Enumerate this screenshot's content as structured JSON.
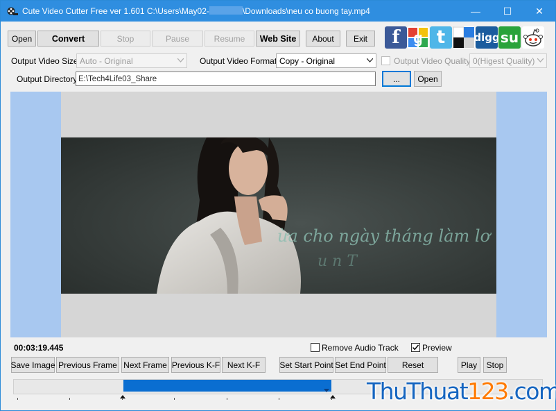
{
  "window": {
    "title_prefix": "Cute Video Cutter Free ver 1.601  C:\\Users\\May02-",
    "title_suffix": "\\Downloads\\neu co buong tay.mp4",
    "minimize": "—",
    "maximize": "☐",
    "close": "✕"
  },
  "toolbar": {
    "open": "Open",
    "convert": "Convert",
    "stop": "Stop",
    "pause": "Pause",
    "resume": "Resume",
    "website": "Web Site",
    "about": "About",
    "exit": "Exit"
  },
  "social": [
    {
      "name": "facebook-icon",
      "glyph": "f",
      "color": "#3b5998"
    },
    {
      "name": "google-icon",
      "glyph": "g",
      "color": "#ffffff"
    },
    {
      "name": "twitter-icon",
      "glyph": "t",
      "color": "#4fb6e8"
    },
    {
      "name": "delicious-icon",
      "glyph": "",
      "color": "#ffffff"
    },
    {
      "name": "digg-icon",
      "glyph": "digg",
      "color": "#1b5c9e"
    },
    {
      "name": "stumbleupon-icon",
      "glyph": "su",
      "color": "#2aa33b"
    },
    {
      "name": "reddit-icon",
      "glyph": "",
      "color": "#ffffff"
    }
  ],
  "options": {
    "video_size_label": "Output Video Size:",
    "video_size_value": "Auto - Original",
    "video_format_label": "Output Video Format:",
    "video_format_value": "Copy - Original",
    "video_quality_label": "Output Video Quality",
    "video_quality_value": "0(Higest Quality)",
    "directory_label": "Output Directory:",
    "directory_value": "E:\\Tech4Life03_Share",
    "browse": "...",
    "open_dir": "Open"
  },
  "video": {
    "overlay_text_1": "ừa cho ngày tháng làm lơ",
    "overlay_text_2": "u n T"
  },
  "playback": {
    "time": "00:03:19.445",
    "remove_audio": "Remove Audio Track",
    "preview": "Preview",
    "save_image": "Save Image",
    "previous_frame": "Previous Frame",
    "next_frame": "Next Frame",
    "previous_kf": "Previous K-F",
    "next_kf": "Next K-F",
    "set_start": "Set  Start Point",
    "set_end": "Set  End Point",
    "reset": "Reset",
    "play": "Play",
    "stop": "Stop"
  },
  "watermark": {
    "part1": "ThuThuat",
    "part2": "123",
    "part3": ".com"
  },
  "colors": {
    "titlebar": "#2f8ee0",
    "selection": "#0a6ed1",
    "preview_side": "#a8c8f0"
  }
}
